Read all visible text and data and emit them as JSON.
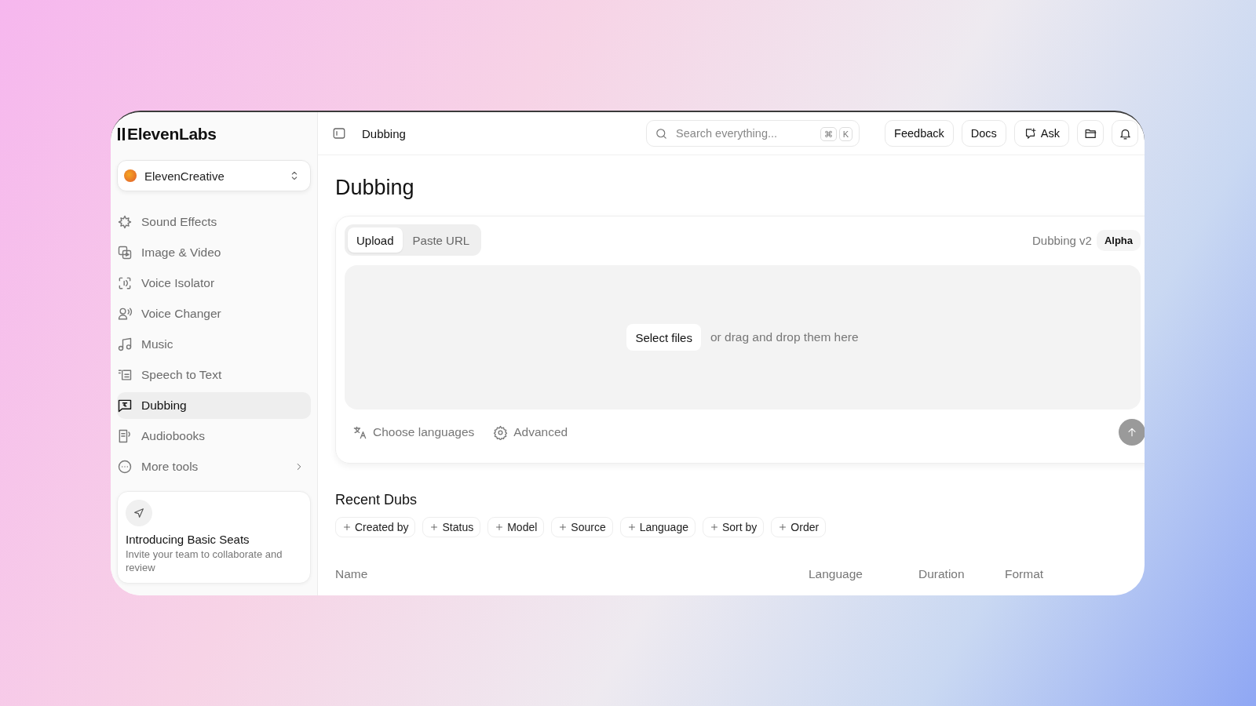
{
  "sidebar": {
    "logo": "ElevenLabs",
    "workspace": {
      "name": "ElevenCreative"
    },
    "items": [
      {
        "label": "Sound Effects",
        "selected": false,
        "kind": "link"
      },
      {
        "label": "Image & Video",
        "selected": false,
        "kind": "link"
      },
      {
        "label": "Voice Isolator",
        "selected": false,
        "kind": "link"
      },
      {
        "label": "Voice Changer",
        "selected": false,
        "kind": "link"
      },
      {
        "label": "Music",
        "selected": false,
        "kind": "link"
      },
      {
        "label": "Speech to Text",
        "selected": false,
        "kind": "link"
      },
      {
        "label": "Dubbing",
        "selected": true,
        "kind": "link"
      },
      {
        "label": "Audiobooks",
        "selected": false,
        "kind": "link"
      },
      {
        "label": "More tools",
        "selected": false,
        "kind": "submenu"
      }
    ],
    "promo": {
      "title": "Introducing Basic Seats",
      "text": "Invite your team to collaborate and review"
    }
  },
  "header": {
    "title": "Dubbing",
    "search": {
      "placeholder": "Search everything...",
      "shortcut": [
        "⌘",
        "K"
      ]
    },
    "buttons": [
      {
        "label": "Feedback",
        "kind": "text"
      },
      {
        "label": "Docs",
        "kind": "text"
      },
      {
        "label": "Ask",
        "kind": "icon-text"
      },
      {
        "kind": "folder"
      },
      {
        "kind": "bell"
      }
    ]
  },
  "page": {
    "title": "Dubbing",
    "tabs": [
      {
        "label": "Upload",
        "selected": true
      },
      {
        "label": "Paste URL",
        "selected": false
      }
    ],
    "version": "Dubbing v2",
    "badge": "Alpha",
    "dropzone": {
      "button": "Select files",
      "hint": "or drag and drop them here"
    },
    "options": [
      "Choose languages",
      "Advanced"
    ],
    "submit": {
      "disabled": true
    }
  },
  "recent": {
    "title": "Recent Dubs",
    "filters": [
      "Created by",
      "Status",
      "Model",
      "Source",
      "Language",
      "Sort by",
      "Order"
    ],
    "table": {
      "columns": [
        "Name",
        "Language",
        "Duration",
        "Format"
      ]
    }
  }
}
